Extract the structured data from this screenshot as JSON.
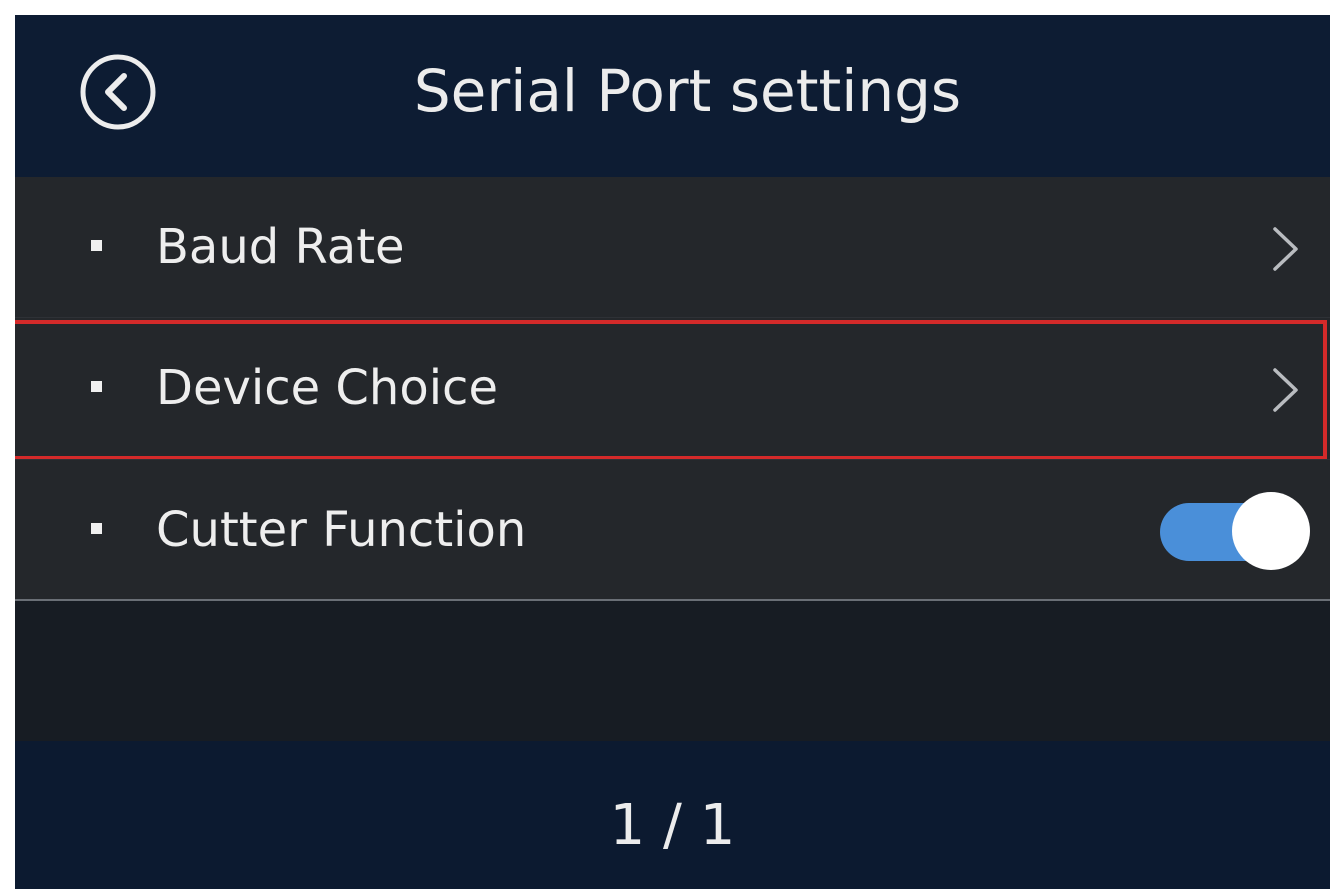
{
  "header": {
    "title": "Serial Port settings",
    "back_icon": "back-circle-icon"
  },
  "settings": {
    "items": [
      {
        "label": "Baud Rate",
        "control": "chevron",
        "icon": "chevron-right-icon"
      },
      {
        "label": "Device Choice",
        "control": "chevron",
        "icon": "chevron-right-icon",
        "highlighted": true
      },
      {
        "label": "Cutter Function",
        "control": "toggle",
        "toggle_on": true
      }
    ]
  },
  "footer": {
    "page_indicator": "1 / 1"
  },
  "colors": {
    "background": "#0c1a30",
    "list_background": "#24272b",
    "toggle_on": "#4a8fd9",
    "highlight_border": "#d42a2a"
  }
}
